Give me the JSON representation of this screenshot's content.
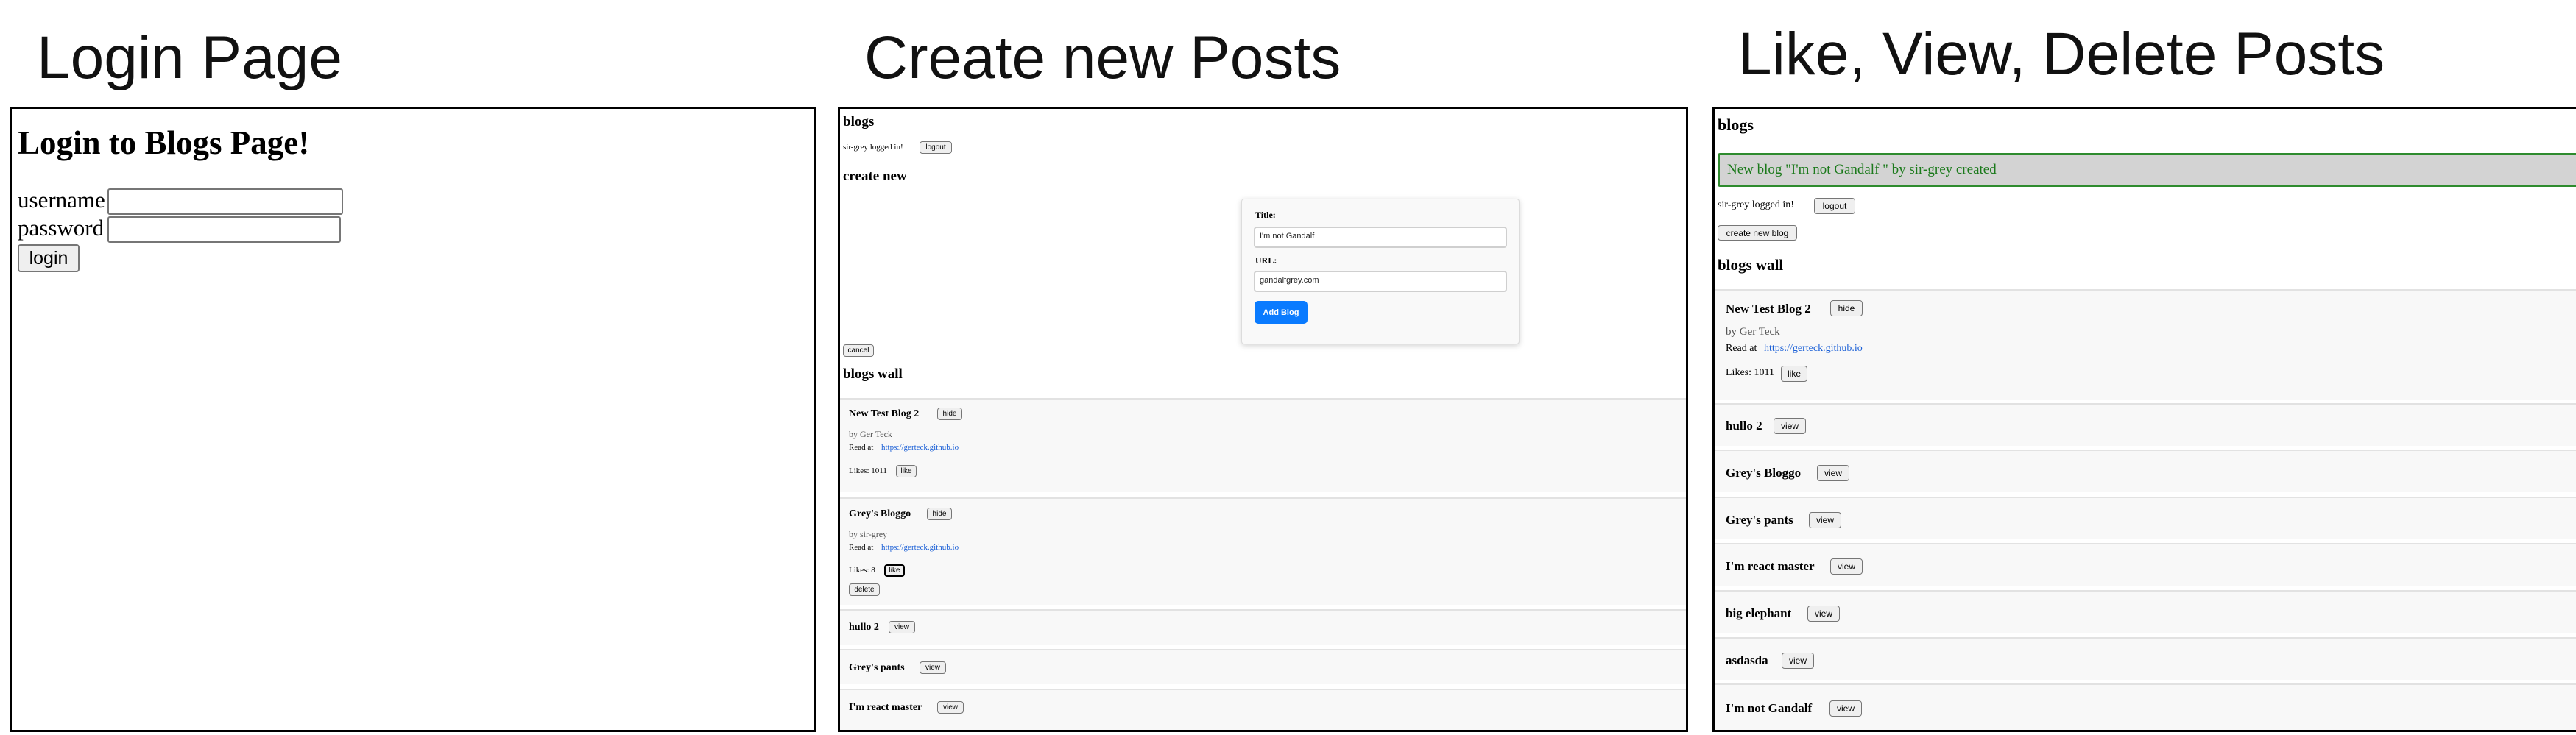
{
  "captions": {
    "login": "Login Page",
    "create": "Create new Posts",
    "like": "Like, View, Delete Posts"
  },
  "login_panel": {
    "heading": "Login to Blogs Page!",
    "username_label": "username",
    "password_label": "password",
    "login_button": "login"
  },
  "create_panel": {
    "title": "blogs",
    "logged_in_text": "sir-grey logged in!",
    "logout_button": "logout",
    "create_heading": "create new",
    "form": {
      "title_label": "Title:",
      "title_value": "I'm not Gandalf",
      "url_label": "URL:",
      "url_value": "gandalfgrey.com",
      "add_button": "Add Blog"
    },
    "cancel_button": "cancel",
    "wall_heading": "blogs wall",
    "blogs": [
      {
        "title": "New Test Blog 2",
        "toggle": "hide",
        "author": "by Ger Teck",
        "read_at": "Read at",
        "url": "https://gerteck.github.io",
        "likes": "Likes: 1011",
        "like_button": "like"
      },
      {
        "title": "Grey's Bloggo",
        "toggle": "hide",
        "author": "by sir-grey",
        "read_at": "Read at",
        "url": "https://gerteck.github.io",
        "likes": "Likes: 8",
        "like_button": "like",
        "delete_button": "delete"
      },
      {
        "title": "hullo 2",
        "toggle": "view"
      },
      {
        "title": "Grey's pants",
        "toggle": "view"
      },
      {
        "title": "I'm react master",
        "toggle": "view"
      }
    ]
  },
  "like_panel": {
    "title": "blogs",
    "notification": "New blog \"I'm not Gandalf \" by sir-grey created",
    "logged_in_text": "sir-grey logged in!",
    "logout_button": "logout",
    "create_button": "create new blog",
    "wall_heading": "blogs wall",
    "blogs": [
      {
        "title": "New Test Blog 2",
        "toggle": "hide",
        "author": "by Ger Teck",
        "read_at": "Read at",
        "url": "https://gerteck.github.io",
        "likes": "Likes: 1011",
        "like_button": "like"
      },
      {
        "title": "hullo 2",
        "toggle": "view"
      },
      {
        "title": "Grey's Bloggo",
        "toggle": "view"
      },
      {
        "title": "Grey's pants",
        "toggle": "view"
      },
      {
        "title": "I'm react master",
        "toggle": "view"
      },
      {
        "title": "big elephant",
        "toggle": "view"
      },
      {
        "title": "asdasda",
        "toggle": "view"
      },
      {
        "title": "I'm not Gandalf",
        "toggle": "view"
      }
    ]
  }
}
